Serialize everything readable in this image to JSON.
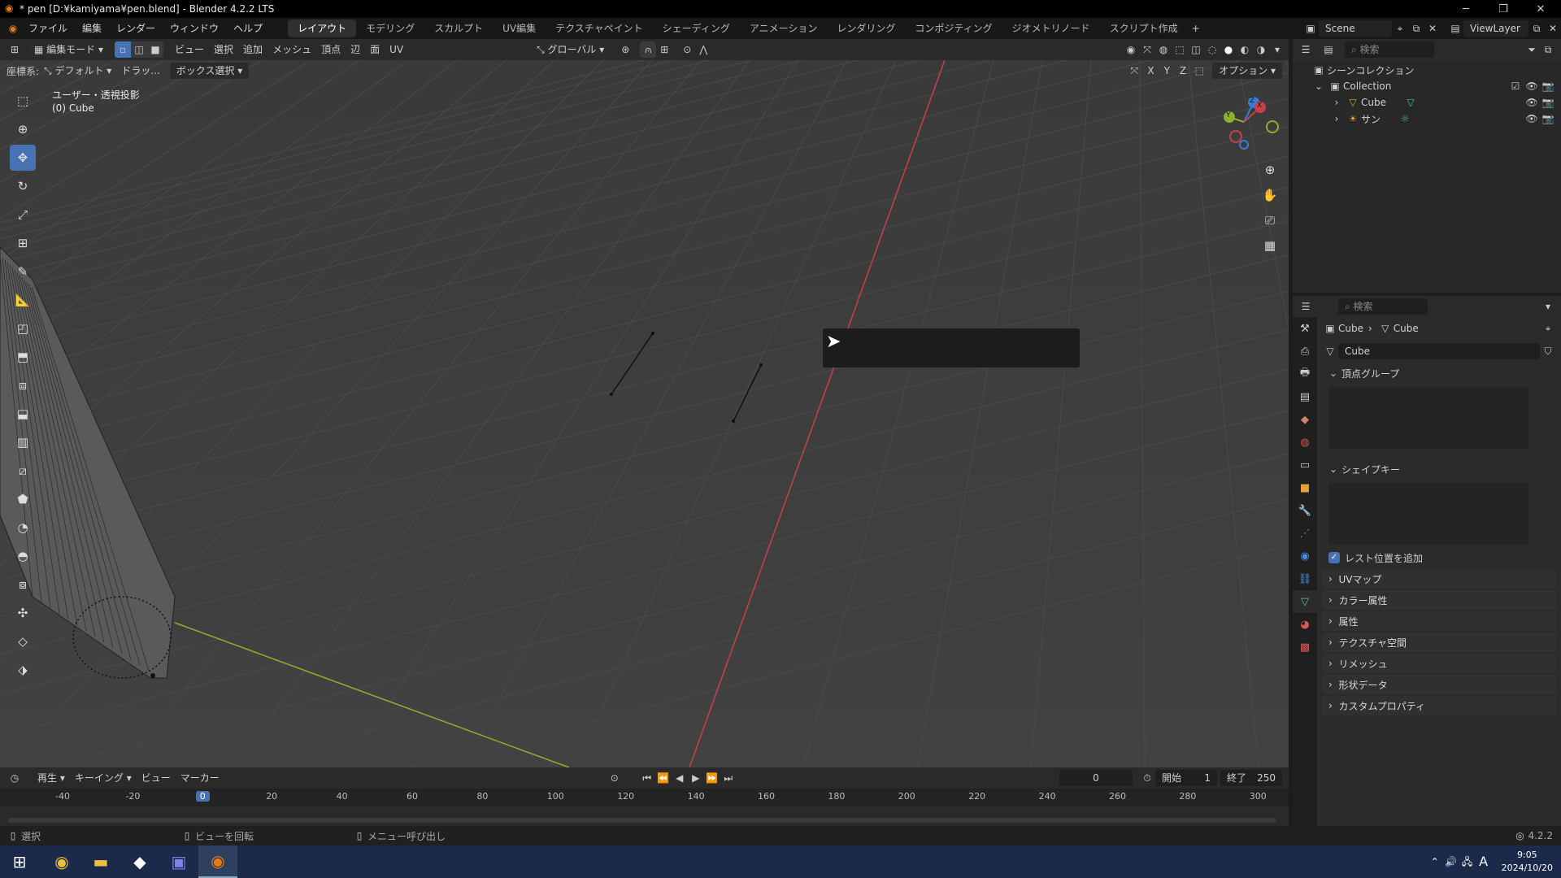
{
  "window": {
    "title": "* pen [D:¥kamiyama¥pen.blend] - Blender 4.2.2 LTS"
  },
  "menu": {
    "items": [
      "ファイル",
      "編集",
      "レンダー",
      "ウィンドウ",
      "ヘルプ"
    ]
  },
  "workspaces": [
    "レイアウト",
    "モデリング",
    "スカルプト",
    "UV編集",
    "テクスチャペイント",
    "シェーディング",
    "アニメーション",
    "レンダリング",
    "コンポジティング",
    "ジオメトリノード",
    "スクリプト作成"
  ],
  "scene": {
    "name": "Scene",
    "view_layer": "ViewLayer"
  },
  "viewport_header": {
    "mode": "編集モード",
    "menus": [
      "ビュー",
      "選択",
      "追加",
      "メッシュ",
      "頂点",
      "辺",
      "面",
      "UV"
    ],
    "transform_orientation": "グローバル",
    "coord_label": "座標系:",
    "coord_value": "デフォルト",
    "drag_label": "ドラッ...",
    "select_mode": "ボックス選択",
    "axes": [
      "X",
      "Y",
      "Z"
    ],
    "options": "オプション"
  },
  "viewport_overlay": {
    "view_name": "ユーザー・透視投影",
    "object_info": "(0) Cube"
  },
  "gizmo": {
    "axis_x": "X",
    "axis_y": "Y",
    "axis_z": "Z"
  },
  "outliner": {
    "search_placeholder": "検索",
    "root": "シーンコレクション",
    "collection": "Collection",
    "items": [
      "Cube",
      "サン"
    ]
  },
  "properties": {
    "search_placeholder": "検索",
    "breadcrumb": [
      "Cube",
      "Cube"
    ],
    "data_name": "Cube",
    "panels": {
      "vertex_groups": "頂点グループ",
      "shape_keys": "シェイプキー",
      "rest_position": "レスト位置を追加",
      "collapsed": [
        "UVマップ",
        "カラー属性",
        "属性",
        "テクスチャ空間",
        "リメッシュ",
        "形状データ",
        "カスタムプロパティ"
      ]
    }
  },
  "timeline": {
    "menus": [
      "再生",
      "キーイング",
      "ビュー",
      "マーカー"
    ],
    "current_frame": "0",
    "start_label": "開始",
    "start": "1",
    "end_label": "終了",
    "end": "250",
    "ruler": [
      "-40",
      "-20",
      "0",
      "20",
      "40",
      "60",
      "80",
      "100",
      "120",
      "140",
      "160",
      "180",
      "200",
      "220",
      "240",
      "260",
      "280",
      "300"
    ]
  },
  "statusbar": {
    "items": [
      "選択",
      "ビューを回転",
      "メニュー呼び出し"
    ],
    "version": "4.2.2"
  },
  "taskbar": {
    "time": "9:05",
    "date": "2024/10/20",
    "ime": "A"
  },
  "colors": {
    "accent": "#4772b3",
    "x_axis": "#c8404a",
    "y_axis": "#8ab22c",
    "z_axis": "#3a7bd5"
  }
}
